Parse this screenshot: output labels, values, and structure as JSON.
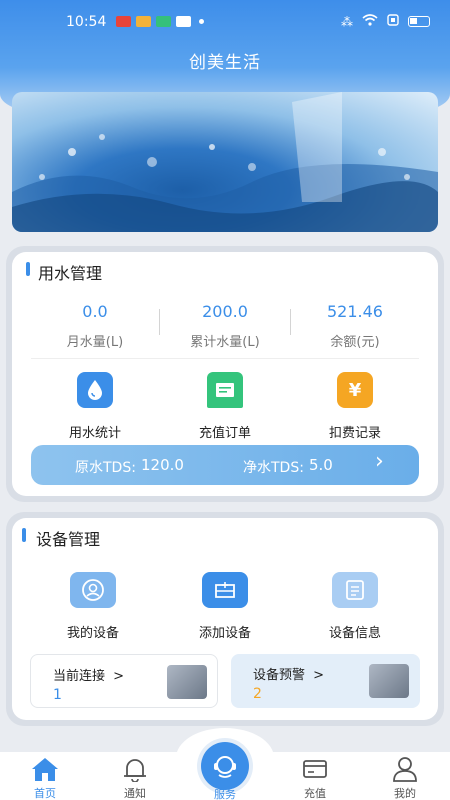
{
  "status_bar": {
    "time": "10:54"
  },
  "app": {
    "title": "创美生活"
  },
  "water": {
    "title": "用水管理",
    "stats": [
      {
        "value": "0.0",
        "label": "月水量(L)"
      },
      {
        "value": "200.0",
        "label": "累计水量(L)"
      },
      {
        "value": "521.46",
        "label": "余额(元)"
      }
    ],
    "actions": [
      {
        "label": "用水统计",
        "icon": "water-drop-icon",
        "color": "#3b8ee8"
      },
      {
        "label": "充值订单",
        "icon": "receipt-icon",
        "color": "#34c47c"
      },
      {
        "label": "扣费记录",
        "icon": "yen-icon",
        "color": "#f5a623",
        "glyph": "¥"
      }
    ],
    "tds": {
      "raw_label": "原水TDS:",
      "raw_value": "120.0",
      "pure_label": "净水TDS:",
      "pure_value": "5.0",
      "arrow": "›"
    }
  },
  "device": {
    "title": "设备管理",
    "actions": [
      {
        "label": "我的设备",
        "icon": "device-user-icon"
      },
      {
        "label": "添加设备",
        "icon": "add-device-icon"
      },
      {
        "label": "设备信息",
        "icon": "device-info-icon"
      }
    ],
    "current": {
      "title": "当前连接",
      "arrow": ">",
      "count": "1"
    },
    "warning": {
      "title": "设备预警",
      "arrow": ">",
      "count": "2"
    }
  },
  "tabbar": {
    "home": "首页",
    "notify": "通知",
    "service": "服务",
    "recharge": "充值",
    "mine": "我的"
  },
  "colors": {
    "accent": "#3b8ee8",
    "warning_orange": "#f5a623"
  }
}
